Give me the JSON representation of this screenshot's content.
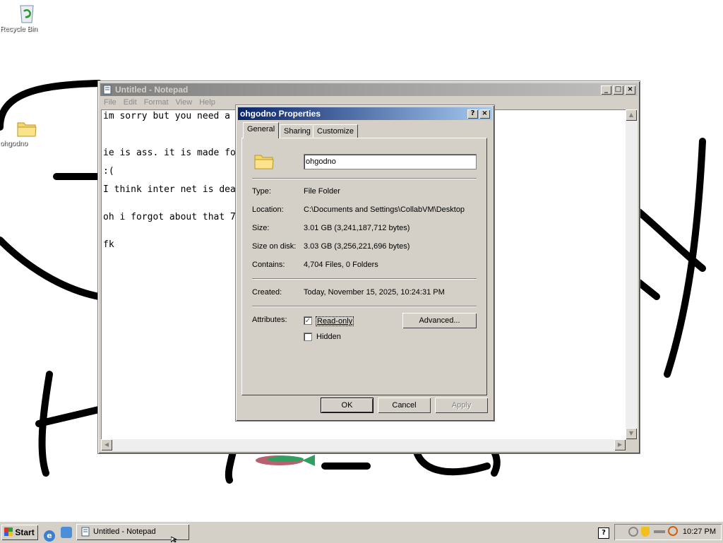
{
  "desktop": {
    "icons": [
      {
        "label": "Recycle Bin",
        "icon": "recycle-bin-icon"
      },
      {
        "label": "ohgodno",
        "icon": "folder-icon"
      }
    ]
  },
  "notepad": {
    "title": "Untitled - Notepad",
    "menu": [
      "File",
      "Edit",
      "Format",
      "View",
      "Help"
    ],
    "lines": [
      "im sorry but you need a",
      "",
      "ie is ass. it is made fo",
      ":(",
      "I think inter net is dea",
      "",
      "oh i forgot about that 7",
      "",
      "fk"
    ]
  },
  "dialog": {
    "title": "ohgodno Properties",
    "help_btn": "?",
    "close_btn": "×",
    "tabs": [
      "General",
      "Sharing",
      "Customize"
    ],
    "name_value": "ohgodno",
    "props": {
      "type_label": "Type:",
      "type_value": "File Folder",
      "location_label": "Location:",
      "location_value": "C:\\Documents and Settings\\CollabVM\\Desktop",
      "size_label": "Size:",
      "size_value": "3.01 GB (3,241,187,712 bytes)",
      "size_on_disk_label": "Size on disk:",
      "size_on_disk_value": "3.03 GB (3,256,221,696 bytes)",
      "contains_label": "Contains:",
      "contains_value": "4,704 Files, 0 Folders",
      "created_label": "Created:",
      "created_value": "Today, November 15, 2025, 10:24:31 PM",
      "attributes_label": "Attributes:"
    },
    "readonly_label": "Read-only",
    "hidden_label": "Hidden",
    "advanced_btn": "Advanced...",
    "ok_btn": "OK",
    "cancel_btn": "Cancel",
    "apply_btn": "Apply",
    "readonly_checked": true,
    "hidden_checked": false
  },
  "taskbar": {
    "start_label": "Start",
    "task_label": "Untitled - Notepad",
    "clock": "10:27 PM"
  },
  "colors": {
    "active_title": "#0a246a",
    "inactive_title": "#808080",
    "face": "#d4d0c8"
  }
}
